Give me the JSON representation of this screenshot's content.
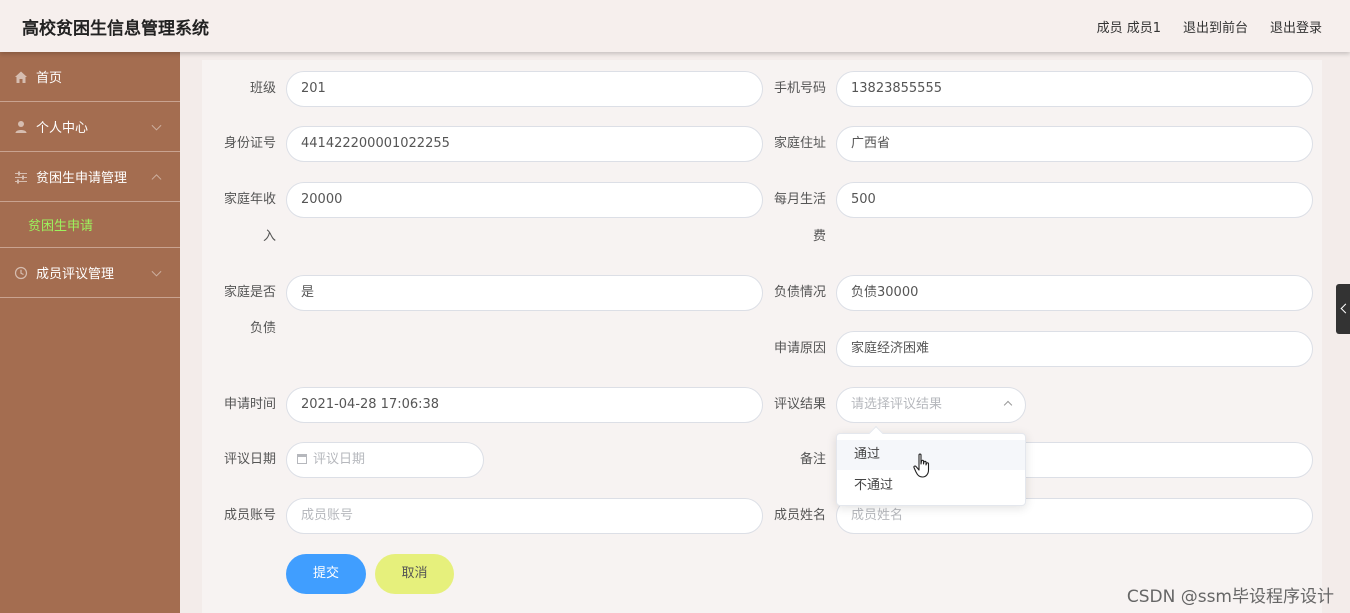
{
  "header": {
    "title": "高校贫困生信息管理系统",
    "user": "成员 成员1",
    "front": "退出到前台",
    "logout": "退出登录"
  },
  "sidebar": {
    "items": [
      {
        "label": "首页",
        "icon": "home-icon"
      },
      {
        "label": "个人中心",
        "icon": "user-icon"
      },
      {
        "label": "贫困生申请管理",
        "icon": "sliders-icon",
        "children": [
          {
            "label": "贫困生申请"
          }
        ]
      },
      {
        "label": "成员评议管理",
        "icon": "clock-icon"
      }
    ]
  },
  "form": {
    "class_label": "班级",
    "class_value": "201",
    "phone_label": "手机号码",
    "phone_value": "13823855555",
    "id_label": "身份证号",
    "id_value": "441422200001022255",
    "address_label": "家庭住址",
    "address_value": "广西省",
    "income_label_1": "家庭年收",
    "income_label_2": "入",
    "income_value": "20000",
    "living_label_1": "每月生活",
    "living_label_2": "费",
    "living_value": "500",
    "debt_q_label_1": "家庭是否",
    "debt_q_label_2": "负债",
    "debt_q_value": "是",
    "debt_label": "负债情况",
    "debt_value": "负债30000",
    "reason_label": "申请原因",
    "reason_value": "家庭经济困难",
    "time_label": "申请时间",
    "time_value": "2021-04-28 17:06:38",
    "result_label": "评议结果",
    "result_placeholder": "请选择评议结果",
    "date_label": "评议日期",
    "date_placeholder": "评议日期",
    "remark_label": "备注",
    "account_label": "成员账号",
    "account_placeholder": "成员账号",
    "name_label": "成员姓名",
    "name_placeholder": "成员姓名",
    "result_options": [
      "通过",
      "不通过"
    ],
    "submit_label": "提交",
    "cancel_label": "取消"
  },
  "watermark": "CSDN @ssm毕设程序设计",
  "colors": {
    "sidebar": "#a46d50",
    "submit": "#409eff",
    "cancel": "#e6f07c",
    "active_sub": "#9df25d"
  }
}
